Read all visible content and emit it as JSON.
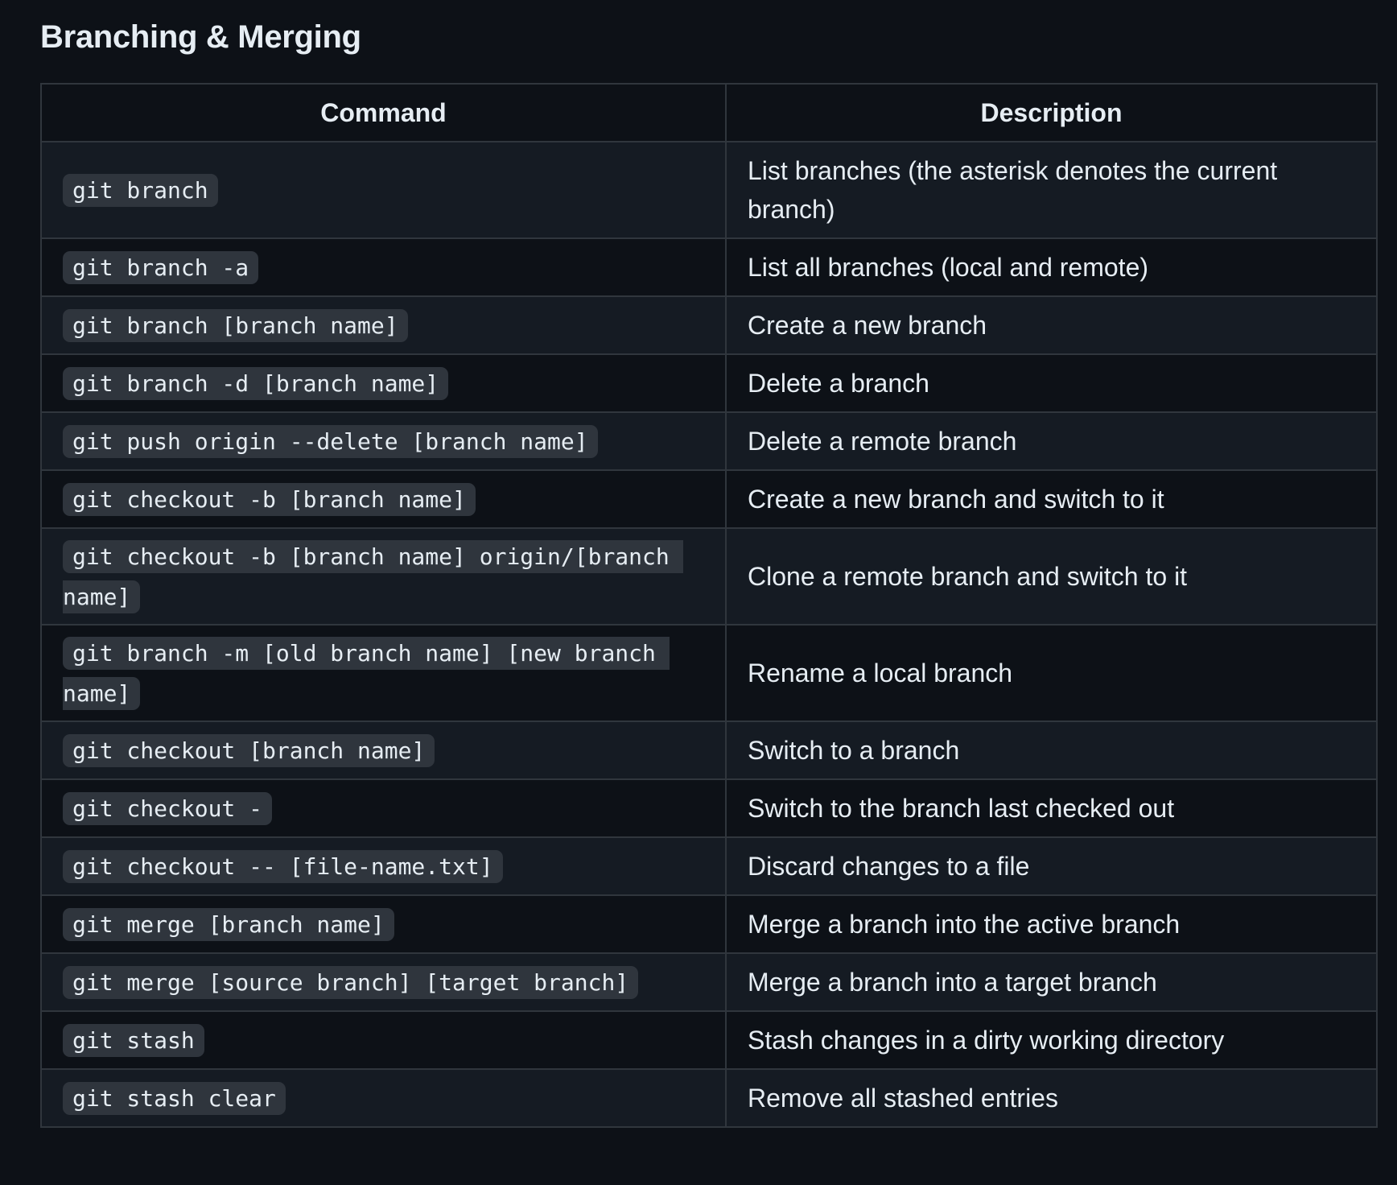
{
  "heading": "Branching & Merging",
  "table": {
    "headers": [
      "Command",
      "Description"
    ],
    "rows": [
      {
        "command": "git branch",
        "description": "List branches (the asterisk denotes the current branch)"
      },
      {
        "command": "git branch -a",
        "description": "List all branches (local and remote)"
      },
      {
        "command": "git branch [branch name]",
        "description": "Create a new branch"
      },
      {
        "command": "git branch -d [branch name]",
        "description": "Delete a branch"
      },
      {
        "command": "git push origin --delete [branch name]",
        "description": "Delete a remote branch"
      },
      {
        "command": "git checkout -b [branch name]",
        "description": "Create a new branch and switch to it"
      },
      {
        "command": "git checkout -b [branch name] origin/[branch name]",
        "description": "Clone a remote branch and switch to it"
      },
      {
        "command": "git branch -m [old branch name] [new branch name]",
        "description": "Rename a local branch"
      },
      {
        "command": "git checkout [branch name]",
        "description": "Switch to a branch"
      },
      {
        "command": "git checkout -",
        "description": "Switch to the branch last checked out"
      },
      {
        "command": "git checkout -- [file-name.txt]",
        "description": "Discard changes to a file"
      },
      {
        "command": "git merge [branch name]",
        "description": "Merge a branch into the active branch"
      },
      {
        "command": "git merge [source branch] [target branch]",
        "description": "Merge a branch into a target branch"
      },
      {
        "command": "git stash",
        "description": "Stash changes in a dirty working directory"
      },
      {
        "command": "git stash clear",
        "description": "Remove all stashed entries"
      }
    ]
  }
}
